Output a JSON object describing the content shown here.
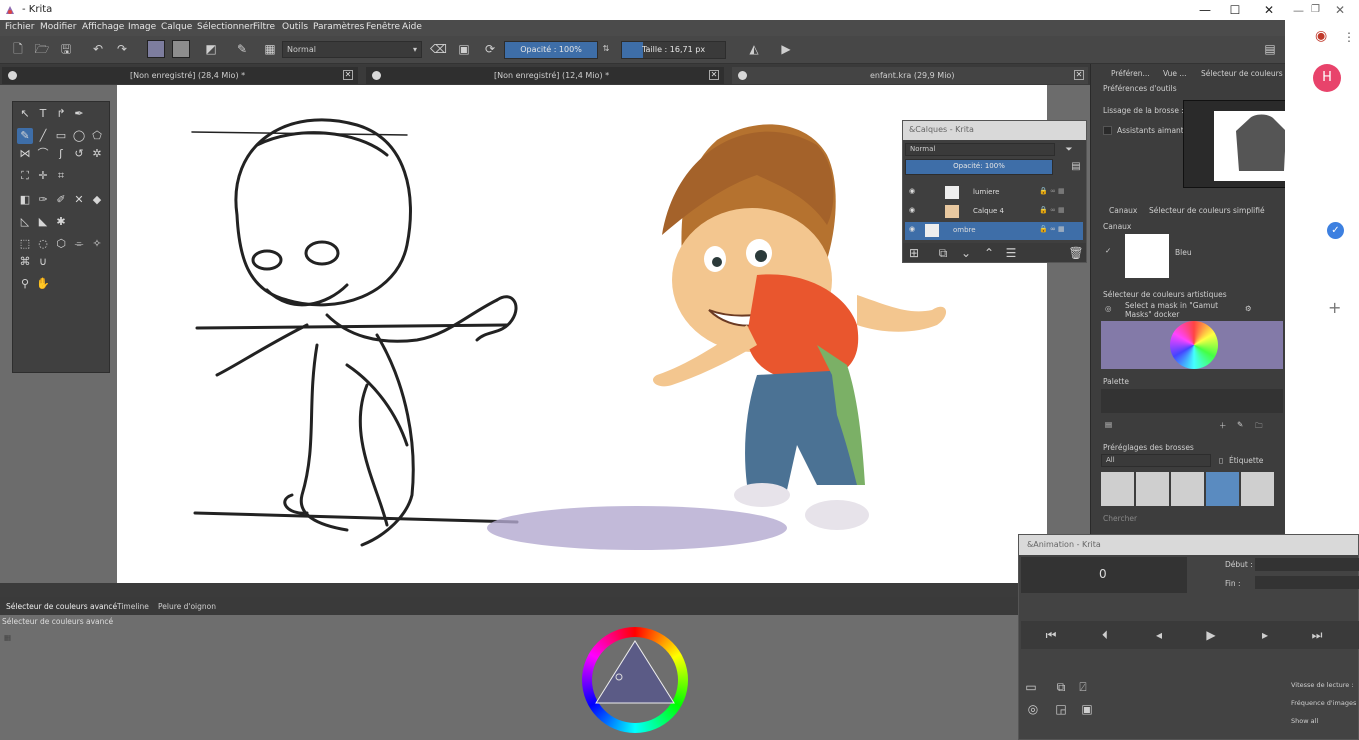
{
  "window": {
    "title": "- Krita",
    "minimize": "—",
    "maximize": "☐",
    "close": "✕"
  },
  "menu": [
    "Fichier",
    "Modifier",
    "Affichage",
    "Image",
    "Calque",
    "Sélectionner",
    "Filtre",
    "Outils",
    "Paramètres",
    "Fenêtre",
    "Aide"
  ],
  "toolbar": {
    "blend_mode": "Normal",
    "opacity_label": "Opacité : 100%",
    "opacity_value": 1.0,
    "size_label": "Taille :  16,71 px",
    "colors": {
      "fg": "#7d7d9e",
      "bg": "#8d8d8d",
      "accent": "#3e6ea8"
    }
  },
  "tabs": [
    {
      "label": "[Non enregistré]  (28,4 Mio) *"
    },
    {
      "label": "[Non enregistré]  (12,4 Mio) *"
    },
    {
      "label": "enfant.kra  (29,9 Mio)"
    }
  ],
  "layers_panel": {
    "title": "&Calques - Krita",
    "blend": "Normal",
    "opacity": "Opacité:  100%",
    "layers": [
      {
        "name": "lumiere",
        "selected": false
      },
      {
        "name": "Calque 4",
        "selected": false
      },
      {
        "name": "ombre",
        "selected": true
      }
    ]
  },
  "docker": {
    "tabs": [
      "Préféren...",
      "Vue ...",
      "Sélecteur de couleurs ..."
    ],
    "tool_prefs": "Préférences d'outils",
    "smoothing": "Lissage de la brosse :",
    "assistants": "Assistants aimantés",
    "channels_tabs": [
      "Canaux",
      "Sélecteur de couleurs simplifié"
    ],
    "channels_title": "Canaux",
    "channel": "Bleu",
    "artistic_title": "Sélecteur de couleurs artistiques",
    "artistic_hint": "Select a mask in \"Gamut Masks\" docker",
    "palette": "Palette",
    "presets_title": "Préréglages des brosses",
    "presets_filter": "All",
    "presets_tag": "Étiquette",
    "presets_bottom": "Chercher"
  },
  "animation": {
    "title": "&Animation - Krita",
    "frame": "0",
    "start_label": "Début :",
    "end_label": "Fin :",
    "speed_label": "Vitesse de lecture :",
    "fps_label": "Fréquence d'images",
    "show_all": "Show all"
  },
  "bottom": {
    "tabs": [
      "Sélecteur de couleurs avancé",
      "Timeline",
      "Pelure d'oignon"
    ],
    "panel_title": "Sélecteur de couleurs avancé"
  },
  "browser": {
    "avatar_letter": "H",
    "avatar_color": "#e8436b"
  }
}
